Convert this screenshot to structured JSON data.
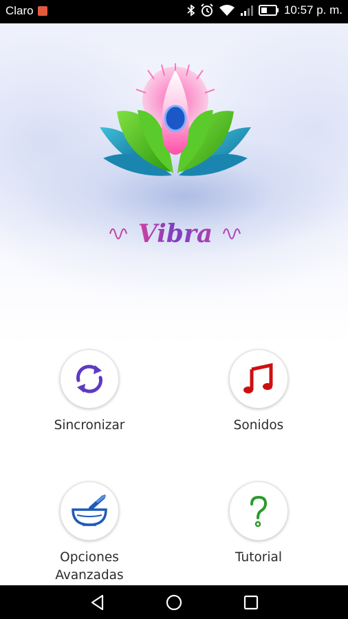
{
  "status_bar": {
    "carrier": "Claro",
    "time": "10:57 p. m.",
    "icons": [
      "notification-badge-icon",
      "bluetooth-icon",
      "alarm-icon",
      "wifi-icon",
      "signal-icon",
      "battery-icon"
    ]
  },
  "app": {
    "logo_text": "Vibra",
    "brand_colors": {
      "pink": "#ff3fa0",
      "green": "#49c21f",
      "teal": "#1aa0b8",
      "blue": "#1c57c7",
      "purple": "#6a3fb5"
    }
  },
  "menu": {
    "items": [
      {
        "label": "Sincronizar",
        "icon": "sync-icon",
        "color": "#5c3bc2"
      },
      {
        "label": "Sonidos",
        "icon": "music-note-icon",
        "color": "#cc1010"
      },
      {
        "label": "Opciones\nAvanzadas",
        "icon": "mortar-pestle-icon",
        "color": "#1e5ab8"
      },
      {
        "label": "Tutorial",
        "icon": "question-mark-icon",
        "color": "#2a9a2a"
      }
    ]
  },
  "nav_bar": {
    "buttons": [
      "back-icon",
      "home-icon",
      "recents-icon"
    ]
  }
}
